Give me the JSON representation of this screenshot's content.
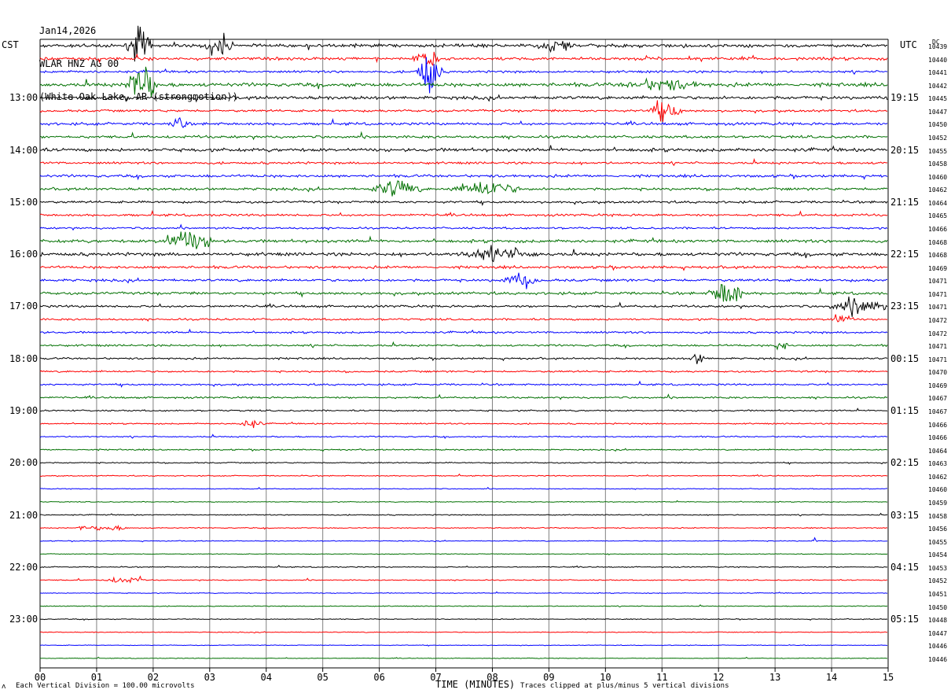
{
  "header": {
    "date": "Jan14,2026",
    "station": "WLAR HNZ AG 00",
    "location": "(White Oak Lake, AR (strongmotion))"
  },
  "left_tz": "CST",
  "right_tz": "UTC",
  "dc_label": "DC",
  "footer": {
    "scale": "Each Vertical Division =  100.00 microvolts",
    "clip": "Traces clipped at plus/minus 5 vertical divisions",
    "corner": "ʌ"
  },
  "colors": {
    "cycle": [
      "#000000",
      "#ff0000",
      "#0000ff",
      "#007000"
    ]
  },
  "chart_data": {
    "type": "line",
    "title": "",
    "xlabel": "TIME (MINUTES)",
    "x_ticks": [
      "00",
      "01",
      "02",
      "03",
      "04",
      "05",
      "06",
      "07",
      "08",
      "09",
      "10",
      "11",
      "12",
      "13",
      "14",
      "15"
    ],
    "xlim": [
      0,
      15
    ],
    "trace_count": 48,
    "minutes_per_trace": 15,
    "left_hour_labels": [
      "13:00",
      "14:00",
      "15:00",
      "16:00",
      "17:00",
      "18:00",
      "19:00",
      "20:00",
      "21:00",
      "22:00",
      "23:00"
    ],
    "right_hour_labels": [
      "19:15",
      "20:15",
      "21:15",
      "22:15",
      "23:15",
      "00:15",
      "01:15",
      "02:15",
      "03:15",
      "04:15",
      "05:15"
    ],
    "dc_values": [
      "10439",
      "10440",
      "10441",
      "10442",
      "10445",
      "10447",
      "10450",
      "10452",
      "10455",
      "10458",
      "10460",
      "10462",
      "10464",
      "10465",
      "10466",
      "10468",
      "10468",
      "10469",
      "10471",
      "10471",
      "10471",
      "10472",
      "10472",
      "10471",
      "10471",
      "10470",
      "10469",
      "10467",
      "10467",
      "10466",
      "10466",
      "10464",
      "10463",
      "10462",
      "10460",
      "10459",
      "10458",
      "10456",
      "10455",
      "10454",
      "10453",
      "10452",
      "10451",
      "10450",
      "10448",
      "10447",
      "10446",
      "10446"
    ],
    "trace_activity": [
      1.0,
      0.9,
      0.7,
      1.1,
      1.0,
      0.7,
      0.8,
      0.8,
      1.0,
      0.7,
      0.8,
      0.8,
      0.7,
      0.7,
      0.6,
      0.9,
      1.0,
      0.8,
      0.8,
      0.8,
      0.7,
      0.6,
      0.6,
      0.6,
      0.55,
      0.55,
      0.55,
      0.55,
      0.45,
      0.4,
      0.4,
      0.4,
      0.35,
      0.3,
      0.25,
      0.25,
      0.3,
      0.3,
      0.25,
      0.2,
      0.3,
      0.3,
      0.25,
      0.25,
      0.25,
      0.25,
      0.2,
      0.2
    ],
    "events": [
      {
        "trace": 0,
        "minute": 1.75,
        "amp": 3.6,
        "dur": 0.25
      },
      {
        "trace": 0,
        "minute": 3.15,
        "amp": 2.5,
        "dur": 0.3
      },
      {
        "trace": 0,
        "minute": 9.15,
        "amp": 1.0,
        "dur": 0.4
      },
      {
        "trace": 1,
        "minute": 6.85,
        "amp": 1.5,
        "dur": 0.3
      },
      {
        "trace": 2,
        "minute": 6.88,
        "amp": 5.0,
        "dur": 0.25
      },
      {
        "trace": 3,
        "minute": 1.8,
        "amp": 4.0,
        "dur": 0.35
      },
      {
        "trace": 3,
        "minute": 11.0,
        "amp": 1.0,
        "dur": 0.8
      },
      {
        "trace": 5,
        "minute": 11.05,
        "amp": 2.2,
        "dur": 0.35
      },
      {
        "trace": 6,
        "minute": 2.45,
        "amp": 1.2,
        "dur": 0.2
      },
      {
        "trace": 11,
        "minute": 6.3,
        "amp": 1.8,
        "dur": 0.5
      },
      {
        "trace": 11,
        "minute": 7.9,
        "amp": 1.5,
        "dur": 0.7
      },
      {
        "trace": 15,
        "minute": 2.6,
        "amp": 2.0,
        "dur": 0.6
      },
      {
        "trace": 16,
        "minute": 8.1,
        "amp": 1.2,
        "dur": 0.8
      },
      {
        "trace": 18,
        "minute": 8.5,
        "amp": 1.2,
        "dur": 0.4
      },
      {
        "trace": 19,
        "minute": 12.15,
        "amp": 3.0,
        "dur": 0.35
      },
      {
        "trace": 20,
        "minute": 14.5,
        "amp": 1.6,
        "dur": 0.6
      },
      {
        "trace": 21,
        "minute": 14.15,
        "amp": 1.0,
        "dur": 0.3
      },
      {
        "trace": 23,
        "minute": 13.1,
        "amp": 1.2,
        "dur": 0.15
      },
      {
        "trace": 24,
        "minute": 11.65,
        "amp": 1.0,
        "dur": 0.2
      },
      {
        "trace": 29,
        "minute": 3.7,
        "amp": 0.8,
        "dur": 0.3
      },
      {
        "trace": 37,
        "minute": 0.75,
        "amp": 0.6,
        "dur": 0.1
      },
      {
        "trace": 37,
        "minute": 1.2,
        "amp": 0.6,
        "dur": 0.4
      },
      {
        "trace": 38,
        "minute": 13.7,
        "amp": 0.8,
        "dur": 0.05
      },
      {
        "trace": 41,
        "minute": 1.45,
        "amp": 0.6,
        "dur": 0.4
      },
      {
        "trace": 41,
        "minute": 1.75,
        "amp": 0.5,
        "dur": 0.1
      }
    ]
  }
}
